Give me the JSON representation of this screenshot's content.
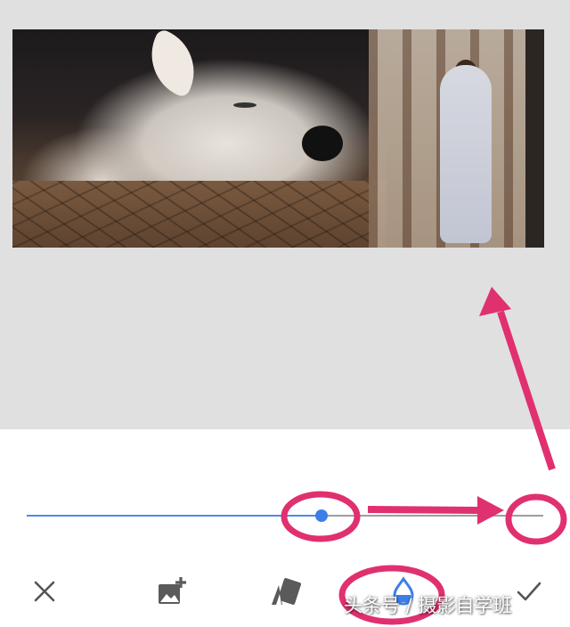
{
  "editor": {
    "canvas_background": "#e0e0e0",
    "image": {
      "layers": [
        "dog-photo",
        "woman-photo"
      ]
    },
    "opacity_slider": {
      "value": 0.57,
      "fill_color": "#4a8be8",
      "track_color": "#9e9e9e"
    },
    "toolbar": {
      "icons": [
        "close-icon",
        "add-image-icon",
        "blend-mode-icon",
        "opacity-icon",
        "checkmark-icon"
      ],
      "active": "opacity-icon",
      "accent_color": "#3d7fe6"
    }
  },
  "annotations": {
    "color": "#e0306f"
  },
  "watermark": {
    "text": "头条号 / 摄影自学班"
  }
}
